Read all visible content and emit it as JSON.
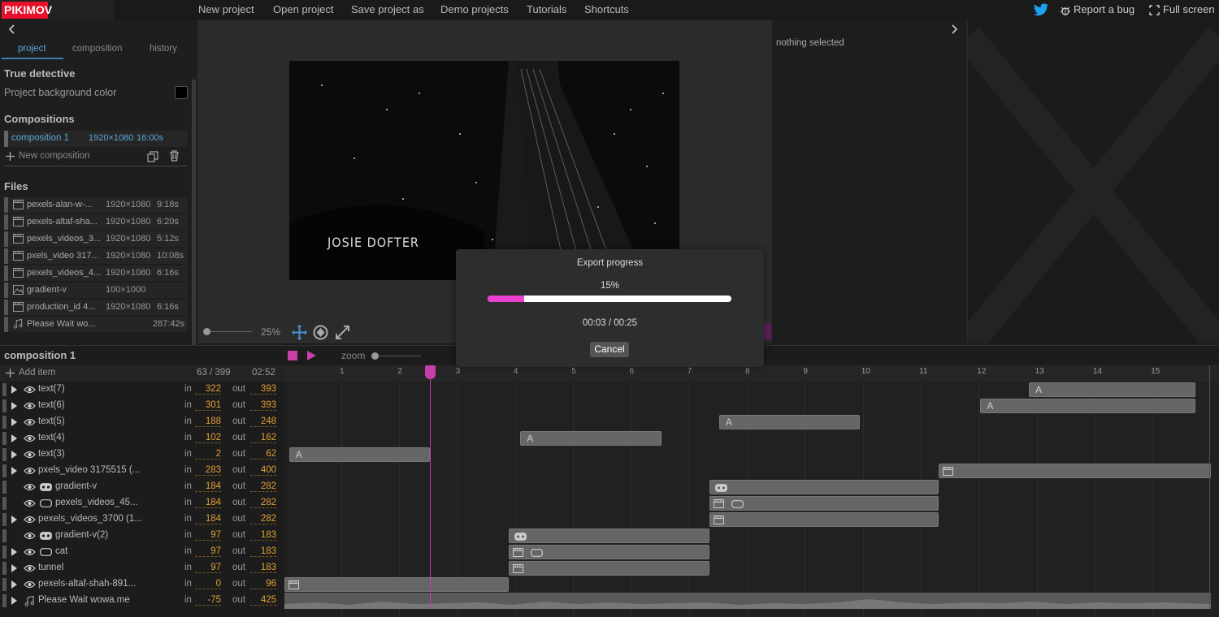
{
  "app": {
    "logo": "PIKIMOV"
  },
  "menu": [
    "New project",
    "Open project",
    "Save project as",
    "Demo projects",
    "Tutorials",
    "Shortcuts"
  ],
  "top_right": {
    "report_bug": "Report a bug",
    "full_screen": "Full screen"
  },
  "left_panel": {
    "tabs": [
      "project",
      "composition",
      "history"
    ],
    "active_tab": "project",
    "project_name": "True detective",
    "bg_color_label": "Project background color",
    "compositions_title": "Compositions",
    "composition": {
      "name": "composition 1",
      "size": "1920×1080",
      "duration": "16:00s"
    },
    "new_composition": "New composition",
    "files_title": "Files",
    "files": [
      {
        "name": "pexels-alan-w-...",
        "size": "1920×1080",
        "duration": "9:18s",
        "icon": "film-icon"
      },
      {
        "name": "pexels-altaf-sha...",
        "size": "1920×1080",
        "duration": "6:20s",
        "icon": "film-icon"
      },
      {
        "name": "pexels_videos_3...",
        "size": "1920×1080",
        "duration": "5:12s",
        "icon": "film-icon"
      },
      {
        "name": "pxels_video 317...",
        "size": "1920×1080",
        "duration": "10:08s",
        "icon": "film-icon"
      },
      {
        "name": "pexels_videos_4...",
        "size": "1920×1080",
        "duration": "6:16s",
        "icon": "film-icon"
      },
      {
        "name": "gradient-v",
        "size": "100×1000",
        "duration": "",
        "icon": "image-icon"
      },
      {
        "name": "production_id 4...",
        "size": "1920×1080",
        "duration": "6:16s",
        "icon": "film-icon"
      },
      {
        "name": "Please Wait wo...",
        "size": "",
        "duration": "287:42s",
        "icon": "music-icon"
      }
    ]
  },
  "preview": {
    "zoom": "25%",
    "caption": "JOSIE DOFTER"
  },
  "right_panel": {
    "status": "nothing selected"
  },
  "timeline": {
    "comp_name": "composition 1",
    "add_item": "Add item",
    "frame_counter": "63 / 399",
    "time": "02:52",
    "zoom_label": "zoom",
    "ruler": [
      "1",
      "2",
      "3",
      "4",
      "5",
      "6",
      "7",
      "8",
      "9",
      "10",
      "11",
      "12",
      "13",
      "14",
      "15"
    ],
    "in_label": "in",
    "out_label": "out",
    "layers": [
      {
        "name": "text(7)",
        "in": "322",
        "out": "393"
      },
      {
        "name": "text(6)",
        "in": "301",
        "out": "393"
      },
      {
        "name": "text(5)",
        "in": "188",
        "out": "248"
      },
      {
        "name": "text(4)",
        "in": "102",
        "out": "162"
      },
      {
        "name": "text(3)",
        "in": "2",
        "out": "62"
      },
      {
        "name": "pxels_video 3175515 (...",
        "in": "283",
        "out": "400"
      },
      {
        "name": "gradient-v",
        "in": "184",
        "out": "282"
      },
      {
        "name": "pexels_videos_45...",
        "in": "184",
        "out": "282"
      },
      {
        "name": "pexels_videos_3700 (1...",
        "in": "184",
        "out": "282"
      },
      {
        "name": "gradient-v(2)",
        "in": "97",
        "out": "183"
      },
      {
        "name": "cat",
        "in": "97",
        "out": "183"
      },
      {
        "name": "tunnel",
        "in": "97",
        "out": "183"
      },
      {
        "name": "pexels-altaf-shah-891...",
        "in": "0",
        "out": "96"
      },
      {
        "name": "Please Wait wowa.me",
        "in": "-75",
        "out": "425"
      }
    ],
    "clip_text_glyph": "A"
  },
  "export_modal": {
    "title": "Export progress",
    "percent_label": "15%",
    "progress": 0.15,
    "time": "00:03 / 00:25",
    "cancel": "Cancel"
  },
  "colors": {
    "accent_pink": "#ea3fcf",
    "logo_red": "#e8102a",
    "in_out_orange": "#e0a035",
    "tab_blue": "#5aa9d8"
  }
}
